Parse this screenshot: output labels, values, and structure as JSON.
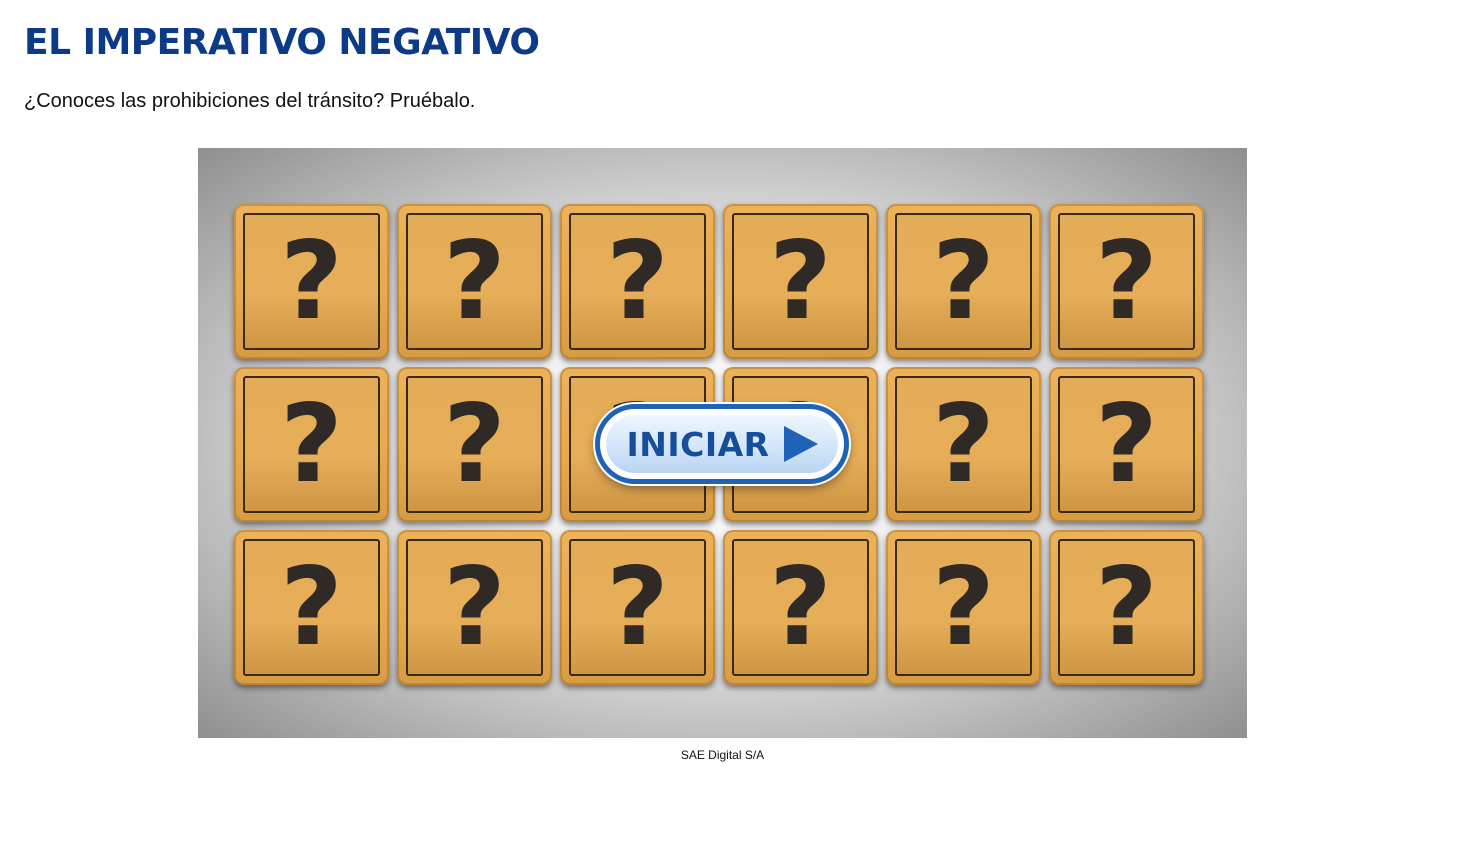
{
  "header": {
    "title": "EL IMPERATIVO NEGATIVO",
    "subtitle": "¿Conoces las prohibiciones del tránsito? Pruébalo."
  },
  "game": {
    "rows": 3,
    "columns": 6,
    "card_symbol": "?",
    "start_button_label": "INICIAR",
    "start_button_icon": "play-icon"
  },
  "caption": "SAE Digital S/A",
  "colors": {
    "title": "#0d3a87",
    "card": "#e6aa50",
    "button_border": "#1f63b8",
    "button_text": "#154f9c"
  }
}
